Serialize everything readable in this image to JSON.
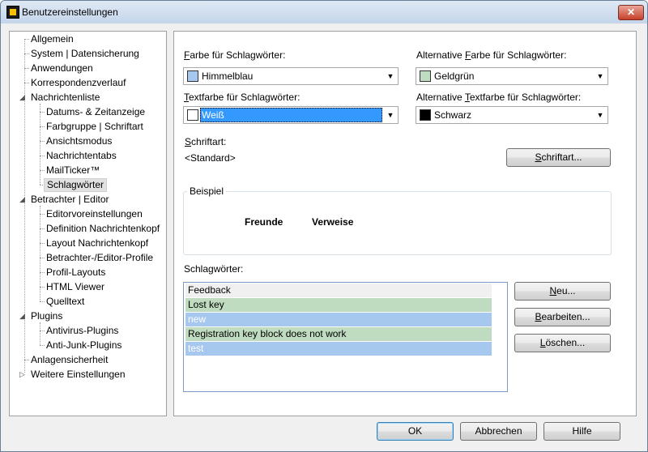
{
  "window": {
    "title": "Benutzereinstellungen"
  },
  "tree": {
    "items": [
      {
        "label": "Allgemein"
      },
      {
        "label": "System | Datensicherung"
      },
      {
        "label": "Anwendungen"
      },
      {
        "label": "Korrespondenzverlauf"
      },
      {
        "label": "Nachrichtenliste"
      },
      {
        "label": "Datums- & Zeitanzeige"
      },
      {
        "label": "Farbgruppe | Schriftart"
      },
      {
        "label": "Ansichtsmodus"
      },
      {
        "label": "Nachrichtentabs"
      },
      {
        "label": "MailTicker™"
      },
      {
        "label": "Schlagwörter"
      },
      {
        "label": "Betrachter | Editor"
      },
      {
        "label": "Editorvoreinstellungen"
      },
      {
        "label": "Definition Nachrichtenkopf"
      },
      {
        "label": "Layout Nachrichtenkopf"
      },
      {
        "label": "Betrachter-/Editor-Profile"
      },
      {
        "label": "Profil-Layouts"
      },
      {
        "label": "HTML Viewer"
      },
      {
        "label": "Quelltext"
      },
      {
        "label": "Plugins"
      },
      {
        "label": "Antivirus-Plugins"
      },
      {
        "label": "Anti-Junk-Plugins"
      },
      {
        "label": "Anlagensicherheit"
      },
      {
        "label": "Weitere Einstellungen"
      }
    ],
    "selected": "Schlagwörter"
  },
  "colors": {
    "keyword_color": {
      "label_first": "F",
      "label_rest": "arbe für Schlagwörter:",
      "value": "Himmelblau",
      "swatch": "#a6c8ee"
    },
    "alt_keyword_color": {
      "label_pre": "Alternative ",
      "label_ul": "F",
      "label_post": "arbe für Schlagwörter:",
      "value": "Geldgrün",
      "swatch": "#c0dcc0"
    },
    "text_color": {
      "label_first": "T",
      "label_rest": "extfarbe für Schlagwörter:",
      "value": "Weiß",
      "swatch": "#ffffff"
    },
    "alt_text_color": {
      "label_pre": "Alternative ",
      "label_ul": "T",
      "label_post": "extfarbe für Schlagwörter:",
      "value": "Schwarz",
      "swatch": "#000000"
    }
  },
  "font": {
    "label_first": "S",
    "label_rest": "chriftart:",
    "value": "<Standard>",
    "button_first": "S",
    "button_rest": "chriftart..."
  },
  "example": {
    "title": "Beispiel",
    "word1": "Freunde",
    "word2": "Verweise"
  },
  "keywords": {
    "label": "Schlagwörter:",
    "rows": [
      {
        "text": "Feedback",
        "bg": "#f0f0f0",
        "fg": "#000000"
      },
      {
        "text": "Lost key",
        "bg": "#c0dcc0",
        "fg": "#000000"
      },
      {
        "text": "new",
        "bg": "#a6c8ee",
        "fg": "#ffffff"
      },
      {
        "text": "Registration key block does not work",
        "bg": "#c0dcc0",
        "fg": "#000000"
      },
      {
        "text": "test",
        "bg": "#a6c8ee",
        "fg": "#ffffff"
      }
    ],
    "new_first": "N",
    "new_rest": "eu...",
    "edit_first": "B",
    "edit_rest": "earbeiten...",
    "delete_first": "L",
    "delete_rest": "öschen..."
  },
  "dialog_buttons": {
    "ok": "OK",
    "cancel": "Abbrechen",
    "help": "Hilfe"
  }
}
